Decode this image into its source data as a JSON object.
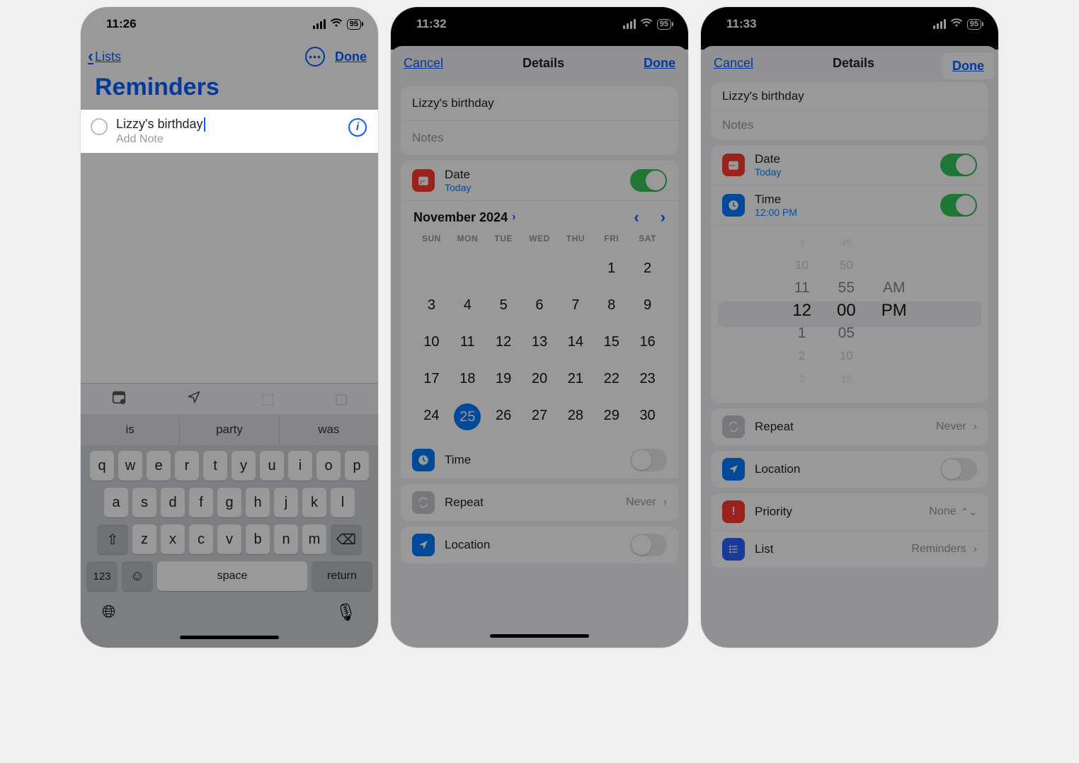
{
  "screen1": {
    "time": "11:26",
    "battery": "95",
    "back_label": "Lists",
    "done_label": "Done",
    "page_title": "Reminders",
    "reminder_title": "Lizzy's birthday",
    "add_note_placeholder": "Add Note",
    "predict": [
      "is",
      "party",
      "was"
    ],
    "key_rows": [
      [
        "q",
        "w",
        "e",
        "r",
        "t",
        "y",
        "u",
        "i",
        "o",
        "p"
      ],
      [
        "a",
        "s",
        "d",
        "f",
        "g",
        "h",
        "j",
        "k",
        "l"
      ],
      [
        "z",
        "x",
        "c",
        "v",
        "b",
        "n",
        "m"
      ]
    ],
    "key_123": "123",
    "key_space": "space",
    "key_return": "return"
  },
  "screen2": {
    "time": "11:32",
    "battery": "95",
    "cancel_label": "Cancel",
    "details_label": "Details",
    "done_label": "Done",
    "reminder_title": "Lizzy's birthday",
    "notes_placeholder": "Notes",
    "date_label": "Date",
    "date_sub": "Today",
    "cal_month": "November 2024",
    "dow": [
      "SUN",
      "MON",
      "TUE",
      "WED",
      "THU",
      "FRI",
      "SAT"
    ],
    "days_leading_blanks": 5,
    "days_count": 30,
    "selected_day": 25,
    "time_label": "Time",
    "repeat_label": "Repeat",
    "repeat_value": "Never",
    "location_label": "Location"
  },
  "screen3": {
    "time": "11:33",
    "battery": "95",
    "cancel_label": "Cancel",
    "details_label": "Details",
    "done_label": "Done",
    "reminder_title": "Lizzy's birthday",
    "notes_placeholder": "Notes",
    "date_label": "Date",
    "date_sub": "Today",
    "time_label": "Time",
    "time_sub": "12:00 PM",
    "wheel_hours": [
      "9",
      "10",
      "11",
      "12",
      "1",
      "2",
      "3"
    ],
    "wheel_mins": [
      "45",
      "50",
      "55",
      "00",
      "05",
      "10",
      "15"
    ],
    "wheel_ampm": [
      "",
      "",
      "AM",
      "PM",
      "",
      "",
      ""
    ],
    "repeat_label": "Repeat",
    "repeat_value": "Never",
    "location_label": "Location",
    "priority_label": "Priority",
    "priority_value": "None",
    "list_label": "List",
    "list_value": "Reminders"
  }
}
